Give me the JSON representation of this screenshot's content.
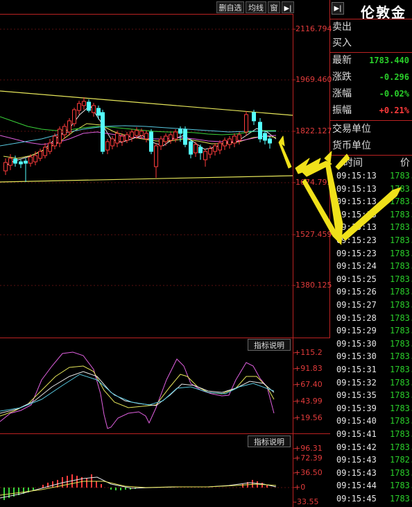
{
  "toolbar": {
    "remove_favorite": "删自选",
    "avg_line": "均线",
    "window": "窗"
  },
  "main_chart": {
    "price_axis": [
      "2116.794",
      "1969.460",
      "1822.127",
      "1674.793",
      "1527.459",
      "1380.125"
    ]
  },
  "kdj_panel": {
    "tab_label": "指标说明",
    "axis": [
      "+115.2",
      "+91.83",
      "+67.40",
      "+43.99",
      "+19.56"
    ]
  },
  "macd_panel": {
    "tab_label": "指标说明",
    "axis": [
      "+96.31",
      "+72.39",
      "+36.50",
      "+0",
      "-33.55"
    ]
  },
  "quote": {
    "title": "伦敦金",
    "sell": "卖出",
    "buy": "买入",
    "latest_label": "最新",
    "latest_value": "1783.440",
    "change_label": "涨跌",
    "change_value": "-0.296",
    "change_pct_label": "涨幅",
    "change_pct_value": "-0.02%",
    "amplitude_label": "振幅",
    "amplitude_value": "+0.21%",
    "trade_unit_label": "交易单位",
    "currency_unit_label": "货币单位"
  },
  "ticks": {
    "col_time": "时间",
    "col_price": "价",
    "rows": [
      {
        "time": "09:15:13",
        "price": "1783."
      },
      {
        "time": "09:15:13",
        "price": "1783."
      },
      {
        "time": "09:15:13",
        "price": "1783."
      },
      {
        "time": "09:15:13",
        "price": "1783."
      },
      {
        "time": "09:15:13",
        "price": "1783."
      },
      {
        "time": "09:15:23",
        "price": "1783."
      },
      {
        "time": "09:15:23",
        "price": "1783."
      },
      {
        "time": "09:15:24",
        "price": "1783."
      },
      {
        "time": "09:15:25",
        "price": "1783."
      },
      {
        "time": "09:15:26",
        "price": "1783."
      },
      {
        "time": "09:15:27",
        "price": "1783."
      },
      {
        "time": "09:15:28",
        "price": "1783."
      },
      {
        "time": "09:15:29",
        "price": "1783."
      },
      {
        "time": "09:15:30",
        "price": "1783."
      },
      {
        "time": "09:15:30",
        "price": "1783."
      },
      {
        "time": "09:15:31",
        "price": "1783."
      },
      {
        "time": "09:15:32",
        "price": "1783."
      },
      {
        "time": "09:15:35",
        "price": "1783."
      },
      {
        "time": "09:15:39",
        "price": "1783."
      },
      {
        "time": "09:15:40",
        "price": "1783."
      },
      {
        "time": "09:15:41",
        "price": "1783."
      },
      {
        "time": "09:15:42",
        "price": "1783."
      },
      {
        "time": "09:15:43",
        "price": "1782."
      },
      {
        "time": "09:15:43",
        "price": "1783."
      },
      {
        "time": "09:15:44",
        "price": "1783."
      },
      {
        "time": "09:15:45",
        "price": "1783."
      }
    ]
  },
  "colors": {
    "up": "#ff3b3b",
    "down": "#54ffff",
    "price_green": "#2ad02a",
    "price_red": "#ff3b3b",
    "trend_line": "#e6e65a",
    "arrow": "#f0e11a"
  },
  "icons": {
    "collapse": "expand-arrow-icon",
    "quote_collapse": "expand-arrow-icon"
  }
}
